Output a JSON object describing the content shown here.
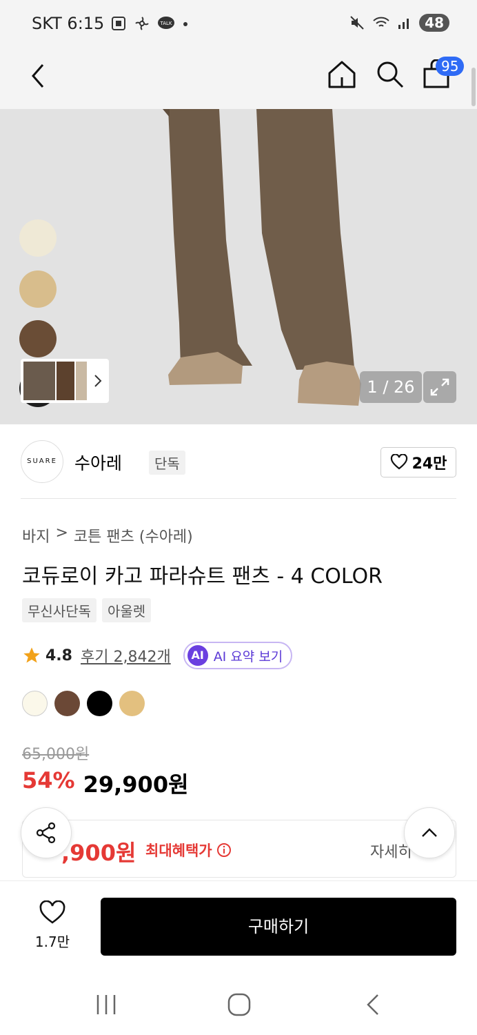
{
  "status_bar": {
    "carrier": "SKT",
    "time": "6:15",
    "battery": "48"
  },
  "nav": {
    "cart_count": "95"
  },
  "hero": {
    "counter": "1 / 26",
    "swatches": [
      "#efe9d6",
      "#d8bd8c",
      "#6a4d36",
      "#1e1e1e"
    ]
  },
  "brand": {
    "logo_text": "SUARE",
    "name": "수아레",
    "tag": "단독",
    "like_count": "24만"
  },
  "breadcrumb": {
    "category": "바지",
    "separator": ">",
    "subcategory": "코튼 팬츠 (수아레)"
  },
  "product": {
    "title": "코듀로이 카고 파라슈트 팬츠 - 4 COLOR",
    "tags": [
      "무신사단독",
      "아울렛"
    ],
    "rating": "4.8",
    "reviews": "후기 2,842개",
    "ai_badge": "AI",
    "ai_label": "AI 요약 보기",
    "colors": [
      "#fbf8ea",
      "#6b4836",
      "#000000",
      "#e3c07f"
    ],
    "original_price": "65,000원",
    "discount": "54%",
    "price": "29,900원"
  },
  "benefit": {
    "price": ",900원",
    "label": "최대혜택가",
    "detail": "자세히"
  },
  "bottom_bar": {
    "wish_count": "1.7만",
    "buy_label": "구매하기"
  }
}
